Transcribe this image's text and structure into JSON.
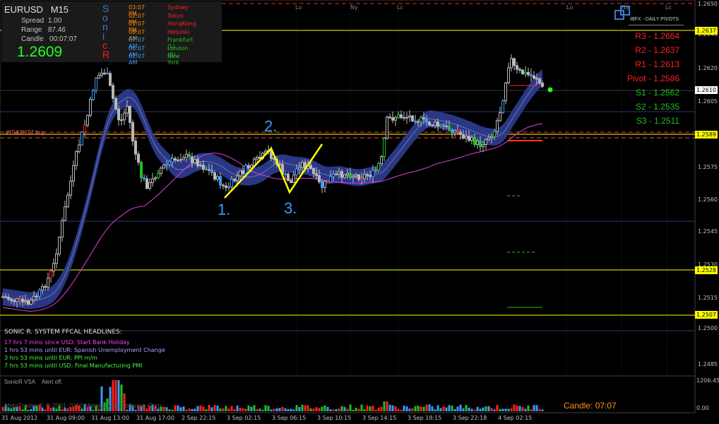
{
  "symbol": "EURUSD",
  "timeframe": "M15",
  "spread_label": "Spread",
  "spread_value": "1.00",
  "range_label": "Range",
  "range_value": "87.46",
  "candle_label": "Candle",
  "candle_value": "00:07:07",
  "bid_price": "1.2609",
  "sonic_letters": [
    "S",
    "o",
    "n",
    "i",
    "c",
    "R"
  ],
  "timezones": [
    {
      "time": "03:07 PM",
      "city": "Sydney",
      "color": "#ff2020"
    },
    {
      "time": "02:07 PM",
      "city": "Tokyo",
      "color": "#ff2020"
    },
    {
      "time": "01:07 PM",
      "city": "HongKong",
      "color": "#ff2020"
    },
    {
      "time": "08:07 AM",
      "city": "Helsinki",
      "color": "#ff2020"
    },
    {
      "time": "07:07 AM",
      "city": "Frankfurt  (L)",
      "color": "#20c020"
    },
    {
      "time": "06:07 AM",
      "city": "London  (B)",
      "color": "#20c020"
    },
    {
      "time": "01:07 AM",
      "city": "New York",
      "color": "#20c020"
    }
  ],
  "tz_time_colors": [
    "#ff8c00",
    "#ff8c00",
    "#ff8c00",
    "#ff8c00",
    "#3aa0ff",
    "#3aa0ff",
    "#3aa0ff"
  ],
  "session_marks": [
    "Lo",
    "Ny",
    "Lc",
    "Lo",
    "Ny",
    "Lc"
  ],
  "pivots_title": "IBFX - DAILY PIVOTS",
  "pivots": [
    {
      "label": "R3 - 1.2664",
      "color": "#ff2020"
    },
    {
      "label": "R2 - 1.2637",
      "color": "#ff2020"
    },
    {
      "label": "R1 - 1.2613",
      "color": "#ff2020"
    },
    {
      "label": "Pivot - 1.2586",
      "color": "#ff2020"
    },
    {
      "label": "S1 - 1.2562",
      "color": "#20c020"
    },
    {
      "label": "S2 - 1.2535",
      "color": "#20c020"
    },
    {
      "label": "S3 - 1.2511",
      "color": "#20c020"
    }
  ],
  "order_label": "#15400157 buy",
  "wave_labels": [
    "1.",
    "2.",
    "3."
  ],
  "price_axis": [
    "1.2650",
    "1.2645",
    "1.2620",
    "1.2605",
    "1.2590",
    "1.2575",
    "1.2560",
    "1.2545",
    "1.2530",
    "1.2515",
    "1.2500",
    "1.2485"
  ],
  "price_tags": [
    {
      "value": "1.2637",
      "style": "yellow"
    },
    {
      "value": "1.2610",
      "style": "white"
    },
    {
      "value": "1.2589",
      "style": "yellow"
    },
    {
      "value": "1.2528",
      "style": "yellow"
    },
    {
      "value": "1.2507",
      "style": "yellow"
    }
  ],
  "headlines_title": "SONIC R. SYSTEM  FFCAL HEADLINES:",
  "headlines": [
    {
      "text": "17 hrs 7 mins since USD: Start Bank Holiday",
      "color": "#ff40ff"
    },
    {
      "text": "1 hrs 53 mins until EUR: Spanish Unemployment Change",
      "color": "#b0a0ff"
    },
    {
      "text": "3 hrs 53 mins until EUR: PPI m/m",
      "color": "#40ff40"
    },
    {
      "text": "7 hrs 53 mins until USD: Final Manufacturing PMI",
      "color": "#40ff40"
    }
  ],
  "vsa_title": "SonicR VSA",
  "vsa_alert": "Alert off.",
  "vsa_axis": [
    "1206.45",
    "0.00"
  ],
  "candle_timer": "Candle:  07:07",
  "watermark": "MetaTrader 4, © 2001-2012 MetaQuotes Software Corp.",
  "time_axis": [
    "31 Aug 2012",
    "31 Aug 09:00",
    "31 Aug 13:00",
    "31 Aug 17:00",
    "2 Sep 22:15",
    "3 Sep 02:15",
    "3 Sep 06:15",
    "3 Sep 10:15",
    "3 Sep 14:15",
    "3 Sep 18:15",
    "3 Sep 22:18",
    "4 Sep 02:15"
  ],
  "colors": {
    "bull": "#c8c8c8",
    "bear": "#c8c8c8",
    "up_blue": "#3a9aff",
    "down_red": "#ff2020",
    "green": "#20c020",
    "band": "#2c3a8c",
    "magenta": "#e040e0",
    "yellow": "#ffff00"
  }
}
